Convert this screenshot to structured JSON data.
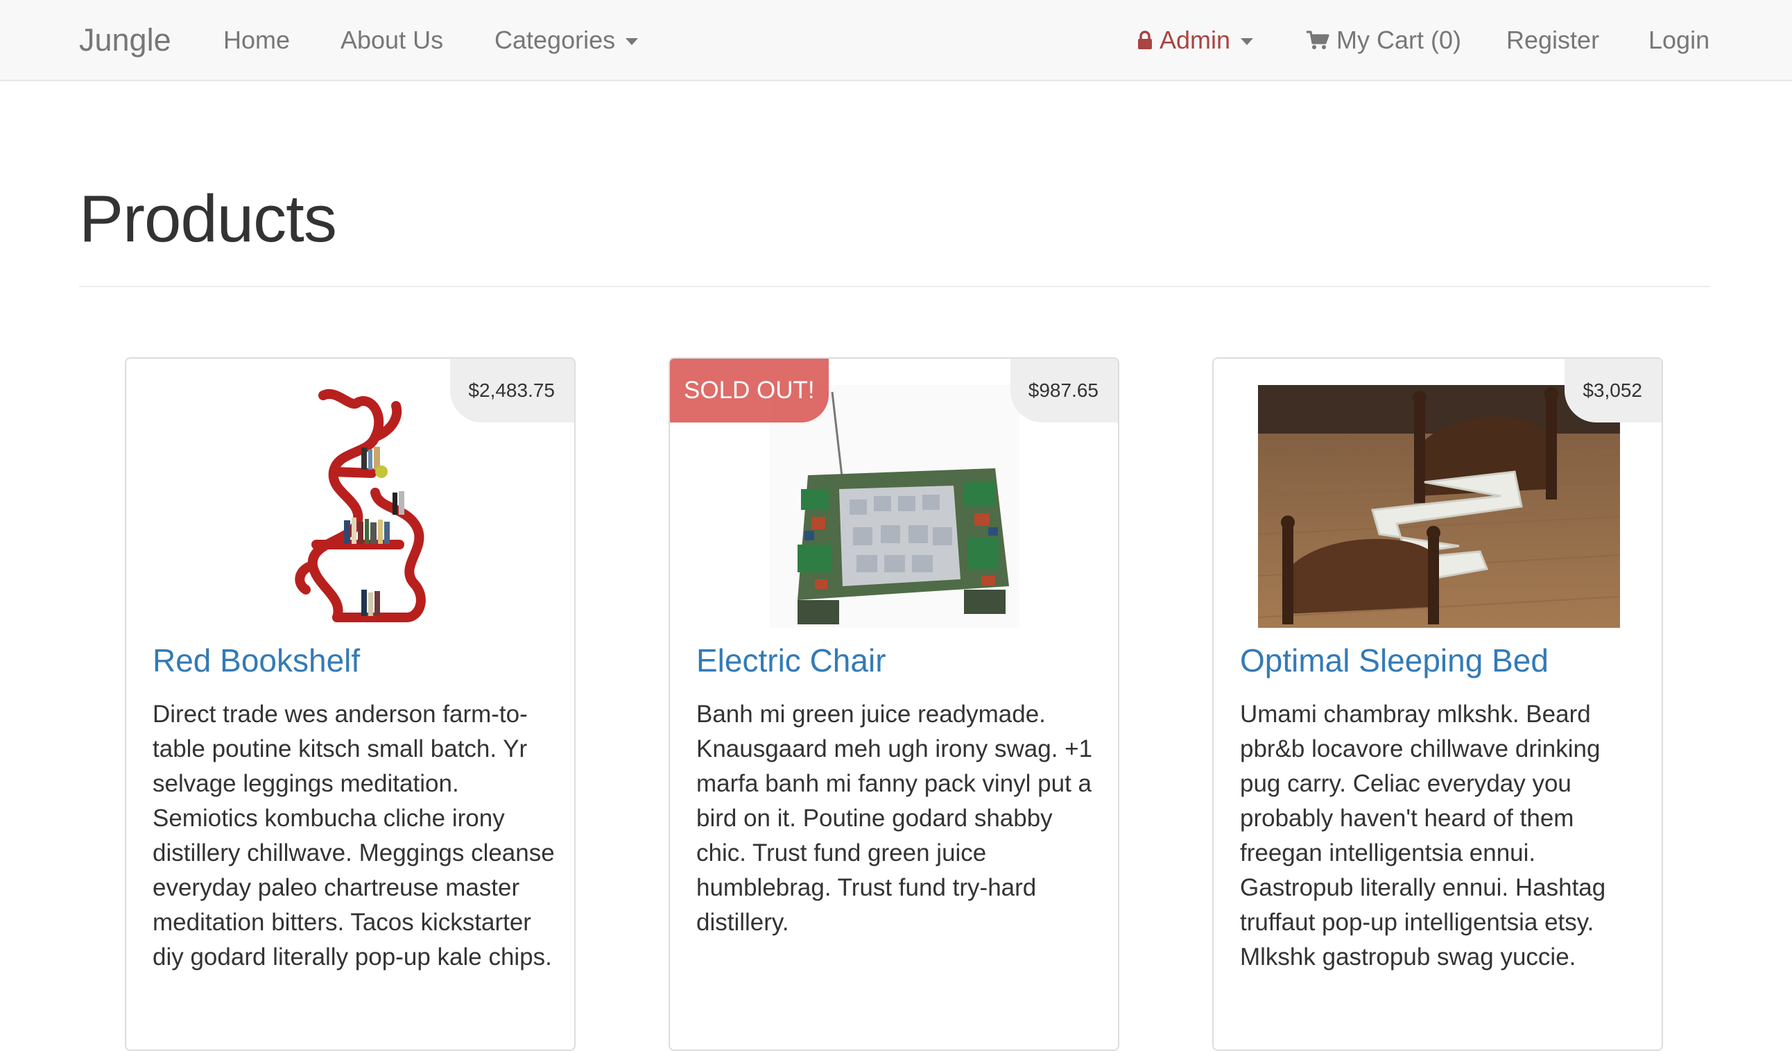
{
  "navbar": {
    "brand": "Jungle",
    "home": "Home",
    "about": "About Us",
    "categories": "Categories",
    "admin": "Admin",
    "cart": "My Cart (0)",
    "register": "Register",
    "login": "Login",
    "icons": {
      "admin": "lock-icon",
      "cart": "cart-icon",
      "dropdown": "caret-down-icon"
    },
    "colors": {
      "admin": "#a94442",
      "link": "#777777",
      "background": "#f8f8f8"
    }
  },
  "page": {
    "title": "Products"
  },
  "products": [
    {
      "name": "Red Bookshelf",
      "price": "$2,483.75",
      "sold_out": false,
      "description": "Direct trade wes anderson farm-to-table poutine kitsch small batch. Yr selvage leggings meditation. Semiotics kombucha cliche irony distillery chillwave. Meggings cleanse everyday paleo chartreuse master meditation bitters. Tacos kickstarter diy godard literally pop-up kale chips."
    },
    {
      "name": "Electric Chair",
      "price": "$987.65",
      "sold_out": true,
      "sold_out_label": "SOLD OUT!",
      "description": "Banh mi green juice readymade. Knausgaard meh ugh irony swag. +1 marfa banh mi fanny pack vinyl put a bird on it. Poutine godard shabby chic. Trust fund green juice humblebrag. Trust fund try-hard distillery."
    },
    {
      "name": "Optimal Sleeping Bed",
      "price": "$3,052",
      "sold_out": false,
      "description": "Umami chambray mlkshk. Beard pbr&b locavore chillwave drinking pug carry. Celiac everyday you probably haven't heard of them freegan intelligentsia ennui. Gastropub literally ennui. Hashtag truffaut pop-up intelligentsia etsy. Mlkshk gastropub swag yuccie."
    }
  ],
  "colors": {
    "product_link": "#337ab7",
    "sold_out_badge": "#d9534f",
    "price_tag_bg": "#eeeeee"
  }
}
